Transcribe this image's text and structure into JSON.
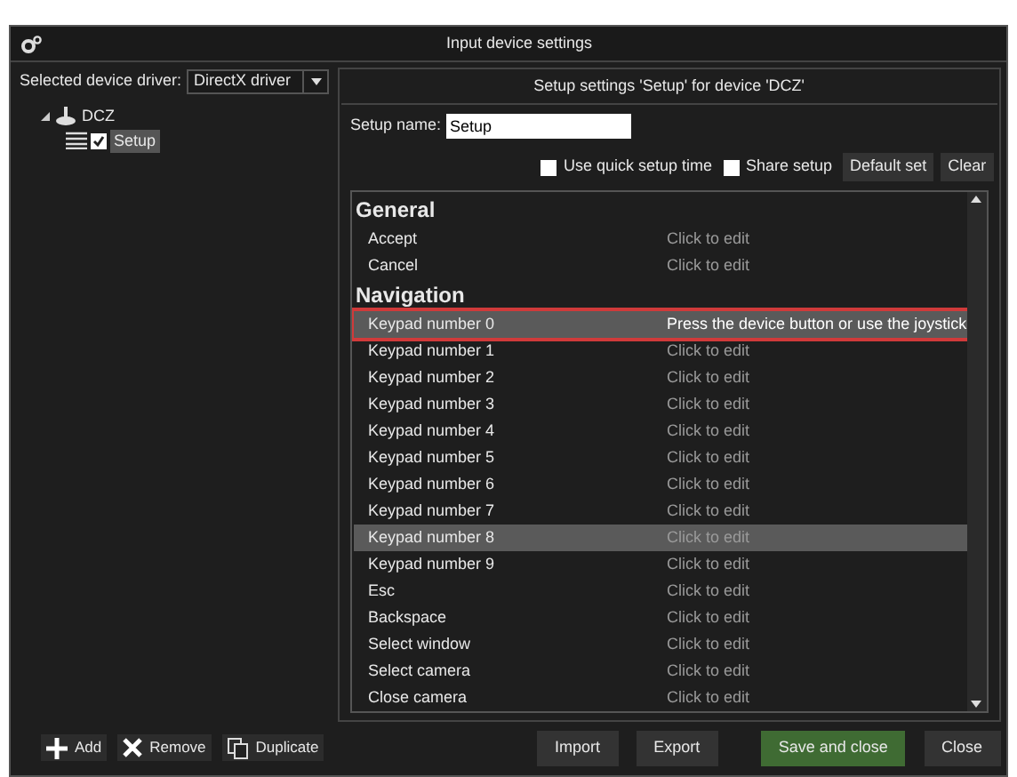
{
  "window": {
    "title": "Input device settings"
  },
  "driver": {
    "label": "Selected device driver:",
    "value": "DirectX driver"
  },
  "tree": [
    {
      "label": "DCZ",
      "expanded": true,
      "children": [
        {
          "label": "Setup",
          "checked": true,
          "selected": true
        }
      ]
    }
  ],
  "panel_title": "Setup settings 'Setup' for device 'DCZ'",
  "setup_name": {
    "label": "Setup name:",
    "value": "Setup"
  },
  "options": [
    {
      "label": "Use quick setup time",
      "checked": false
    },
    {
      "label": "Share setup",
      "checked": false
    }
  ],
  "option_buttons": [
    "Default set",
    "Clear"
  ],
  "groups": [
    {
      "title": "General",
      "rows": [
        {
          "name": "Accept",
          "value": "Click to edit",
          "highlighted": false,
          "editing": false
        },
        {
          "name": "Cancel",
          "value": "Click to edit",
          "highlighted": false,
          "editing": false
        }
      ]
    },
    {
      "title": "Navigation",
      "rows": [
        {
          "name": "Keypad number 0",
          "value": "Press the device button or use the joystick",
          "highlighted": true,
          "editing": true
        },
        {
          "name": "Keypad number 1",
          "value": "Click to edit",
          "highlighted": false,
          "editing": false
        },
        {
          "name": "Keypad number 2",
          "value": "Click to edit",
          "highlighted": false,
          "editing": false
        },
        {
          "name": "Keypad number 3",
          "value": "Click to edit",
          "highlighted": false,
          "editing": false
        },
        {
          "name": "Keypad number 4",
          "value": "Click to edit",
          "highlighted": false,
          "editing": false
        },
        {
          "name": "Keypad number 5",
          "value": "Click to edit",
          "highlighted": false,
          "editing": false
        },
        {
          "name": "Keypad number 6",
          "value": "Click to edit",
          "highlighted": false,
          "editing": false
        },
        {
          "name": "Keypad number 7",
          "value": "Click to edit",
          "highlighted": false,
          "editing": false
        },
        {
          "name": "Keypad number 8",
          "value": "Click to edit",
          "highlighted": true,
          "editing": false
        },
        {
          "name": "Keypad number 9",
          "value": "Click to edit",
          "highlighted": false,
          "editing": false
        },
        {
          "name": "Esc",
          "value": "Click to edit",
          "highlighted": false,
          "editing": false
        },
        {
          "name": "Backspace",
          "value": "Click to edit",
          "highlighted": false,
          "editing": false
        },
        {
          "name": "Select window",
          "value": "Click to edit",
          "highlighted": false,
          "editing": false
        },
        {
          "name": "Select camera",
          "value": "Click to edit",
          "highlighted": false,
          "editing": false
        },
        {
          "name": "Close camera",
          "value": "Click to edit",
          "highlighted": false,
          "editing": false
        }
      ]
    }
  ],
  "left_buttons": [
    {
      "kind": "add",
      "label": "Add"
    },
    {
      "kind": "remove",
      "label": "Remove"
    },
    {
      "kind": "duplicate",
      "label": "Duplicate"
    }
  ],
  "bottom_buttons": [
    {
      "label": "Import",
      "primary": false
    },
    {
      "label": "Export",
      "primary": false
    },
    {
      "label": "Save and close",
      "primary": true
    },
    {
      "label": "Close",
      "primary": false
    }
  ]
}
